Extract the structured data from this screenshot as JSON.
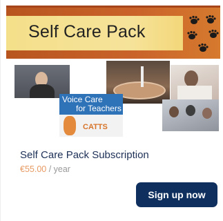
{
  "banner": {
    "title": "Self Care Pack",
    "icon": "paw-print-icons"
  },
  "collage": {
    "voice_card_line1": "Voice Care",
    "voice_card_line2": "for Teachers",
    "voice_card_logo": "CATTS"
  },
  "product": {
    "title": "Self Care Pack Subscription",
    "price": "€55.00",
    "period": " / year"
  },
  "actions": {
    "signup_label": "Sign up now"
  },
  "colors": {
    "banner_accent": "#c9632a",
    "banner_inner": "#f4df8a",
    "title": "#1c2f55",
    "price": "#e89a63",
    "button": "#0f2f5e"
  }
}
